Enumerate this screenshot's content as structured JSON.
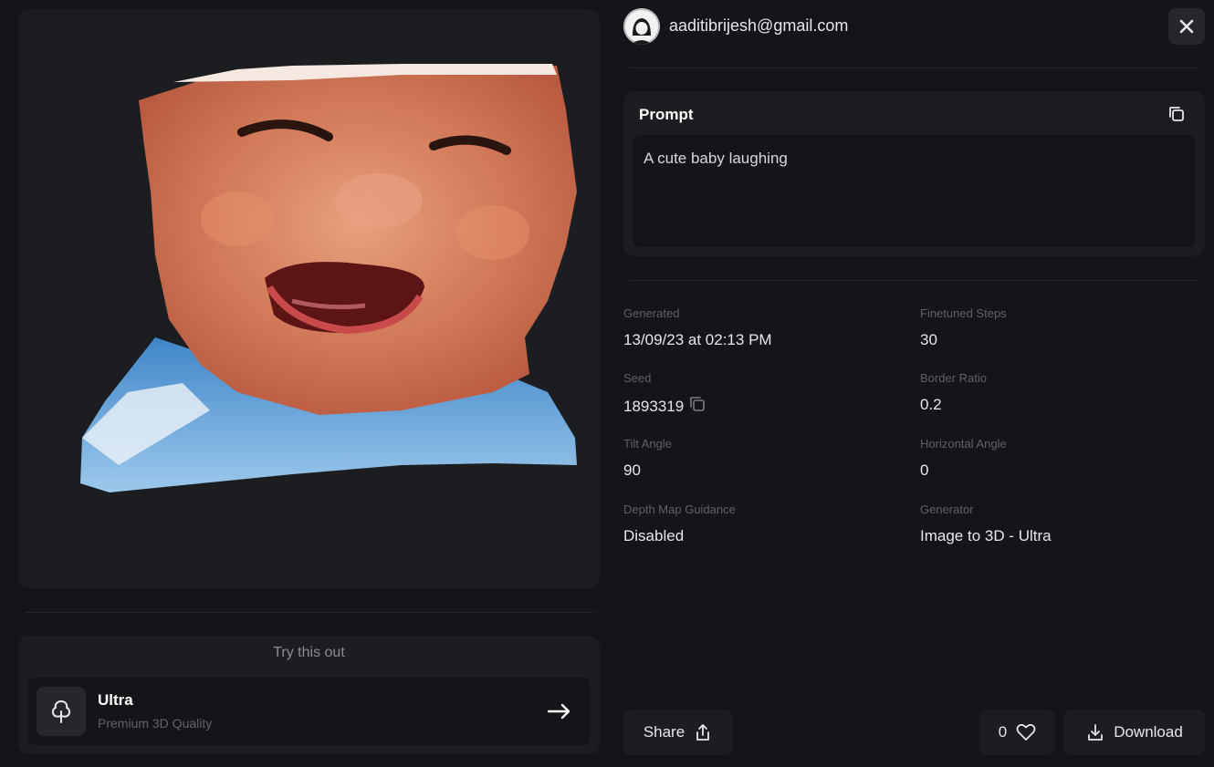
{
  "preview": {
    "alt_name": "baby-3d-model"
  },
  "try_section": {
    "title": "Try this out",
    "item_name": "Ultra",
    "item_subtitle": "Premium 3D Quality"
  },
  "user": {
    "email": "aaditibrijesh@gmail.com"
  },
  "prompt": {
    "title": "Prompt",
    "text": "A cute baby laughing"
  },
  "details": {
    "generated_label": "Generated",
    "generated_value": "13/09/23 at 02:13 PM",
    "steps_label": "Finetuned Steps",
    "steps_value": "30",
    "seed_label": "Seed",
    "seed_value": "1893319",
    "border_label": "Border Ratio",
    "border_value": "0.2",
    "tilt_label": "Tilt Angle",
    "tilt_value": "90",
    "horizontal_label": "Horizontal Angle",
    "horizontal_value": "0",
    "depth_label": "Depth Map Guidance",
    "depth_value": "Disabled",
    "generator_label": "Generator",
    "generator_value": "Image to 3D - Ultra"
  },
  "actions": {
    "share_label": "Share",
    "likes_count": "0",
    "download_label": "Download"
  },
  "colors": {
    "background": "#131519",
    "card": "#1c1d21",
    "button": "#25272c"
  }
}
